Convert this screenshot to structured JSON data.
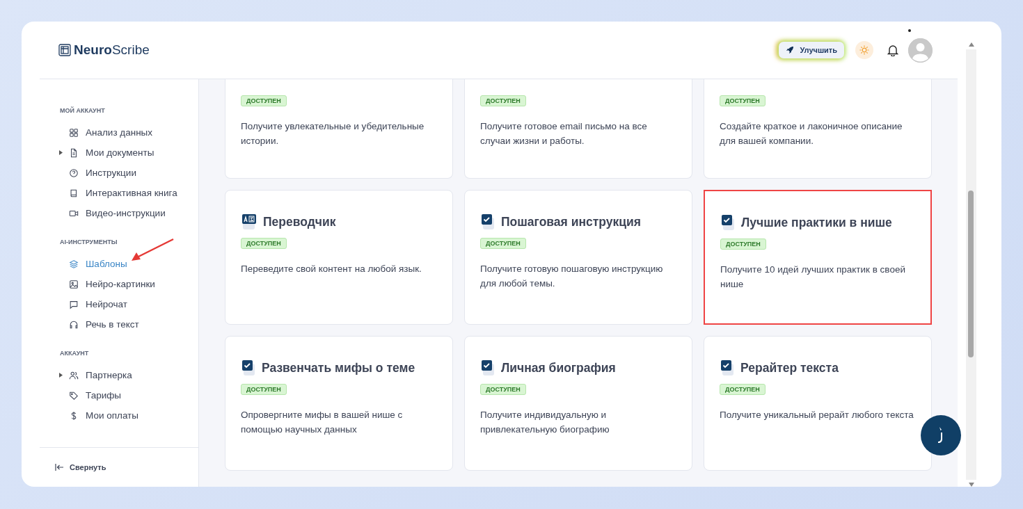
{
  "logo": {
    "bold": "Neuro",
    "rest": "Scribe"
  },
  "header": {
    "upgrade_button": "Улучшить"
  },
  "sidebar": {
    "sections": [
      {
        "title": "МОЙ АККАУНТ",
        "items": [
          {
            "label": "Анализ данных",
            "selected": false,
            "has_submenu": false
          },
          {
            "label": "Мои документы",
            "selected": false,
            "has_submenu": true
          },
          {
            "label": "Инструкции",
            "selected": false,
            "has_submenu": false
          },
          {
            "label": "Интерактивная книга",
            "selected": false,
            "has_submenu": false
          },
          {
            "label": "Видео-инструкции",
            "selected": false,
            "has_submenu": false
          }
        ]
      },
      {
        "title": "AI-ИНСТРУМЕНТЫ",
        "items": [
          {
            "label": "Шаблоны",
            "selected": true,
            "has_submenu": false
          },
          {
            "label": "Нейро-картинки",
            "selected": false,
            "has_submenu": false
          },
          {
            "label": "Нейрочат",
            "selected": false,
            "has_submenu": false
          },
          {
            "label": "Речь в текст",
            "selected": false,
            "has_submenu": false
          }
        ]
      },
      {
        "title": "АККАУНТ",
        "items": [
          {
            "label": "Партнерка",
            "selected": false,
            "has_submenu": true
          },
          {
            "label": "Тарифы",
            "selected": false,
            "has_submenu": false
          },
          {
            "label": "Мои оплаты",
            "selected": false,
            "has_submenu": false
          }
        ]
      }
    ],
    "collapse": "Свернуть"
  },
  "cards": [
    {
      "badge": "ДОСТУПЕН",
      "description": "Получите увлекательные и убедительные истории.",
      "highlighted": false
    },
    {
      "badge": "ДОСТУПЕН",
      "description": "Получите готовое email письмо на все случаи жизни и работы.",
      "highlighted": false
    },
    {
      "badge": "ДОСТУПЕН",
      "description": "Создайте краткое и лаконичное описание для вашей компании.",
      "highlighted": false
    },
    {
      "kind": "translate",
      "title": "Переводчик",
      "badge": "ДОСТУПЕН",
      "description": "Переведите свой контент на любой язык.",
      "highlighted": false
    },
    {
      "kind": "check",
      "title": "Пошаговая инструкция",
      "badge": "ДОСТУПЕН",
      "description": "Получите готовую пошаговую инструкцию для любой темы.",
      "highlighted": false
    },
    {
      "kind": "check",
      "title": "Лучшие практики в нише",
      "badge": "ДОСТУПЕН",
      "description": "Получите 10 идей лучших практик в своей нише",
      "highlighted": true
    },
    {
      "kind": "check",
      "title": "Развенчать мифы о теме",
      "badge": "ДОСТУПЕН",
      "description": "Опровергните мифы в вашей нише с помощью научных данных",
      "highlighted": false
    },
    {
      "kind": "check",
      "title": "Личная биография",
      "badge": "ДОСТУПЕН",
      "description": "Получите индивидуальную и привлекательную биографию",
      "highlighted": false
    },
    {
      "kind": "check",
      "title": "Рерайтер текста",
      "badge": "ДОСТУПЕН",
      "description": "Получите уникальный рерайт любого текста",
      "highlighted": false
    }
  ]
}
